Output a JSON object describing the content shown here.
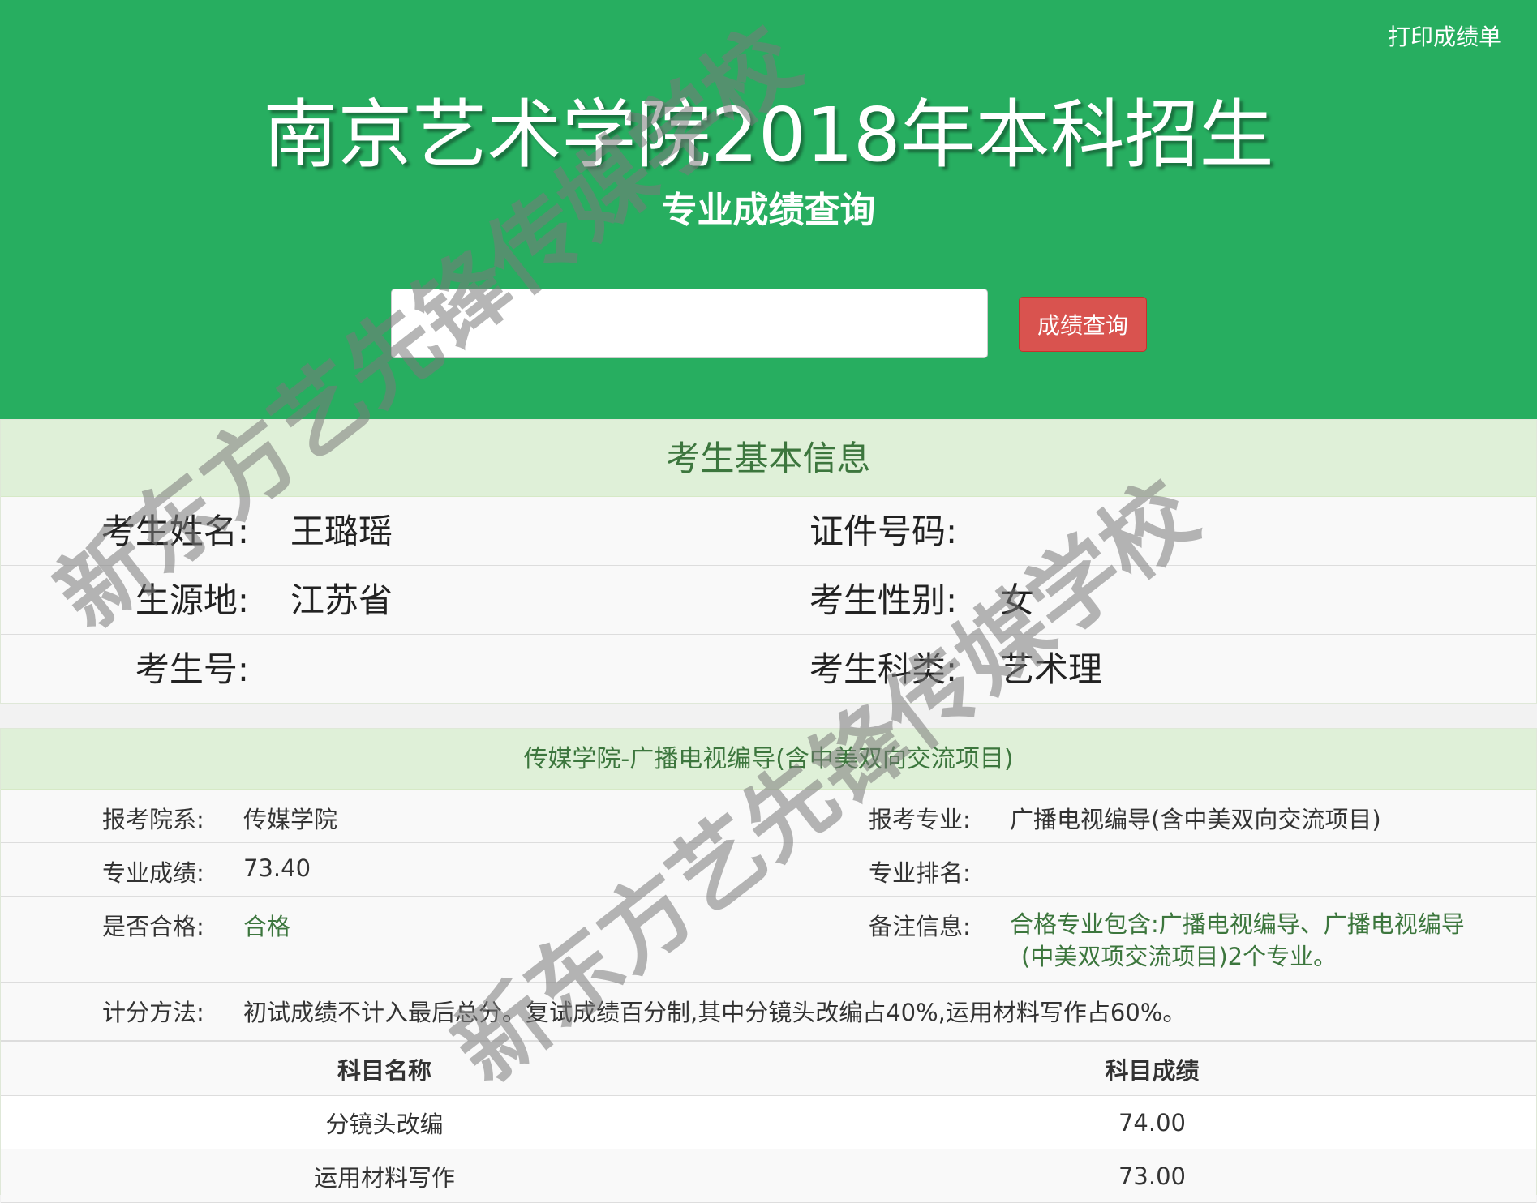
{
  "header": {
    "print_label": "打印成绩单",
    "title": "南京艺术学院2018年本科招生",
    "subtitle": "专业成绩查询",
    "search_value": "",
    "search_button": "成绩查询",
    "colors": {
      "background": "#27ae60",
      "button": "#d9534f"
    }
  },
  "basic_info": {
    "heading": "考生基本信息",
    "rows": [
      {
        "left_label": "考生姓名:",
        "left_value": "王璐瑶",
        "right_label": "证件号码:",
        "right_value": ""
      },
      {
        "left_label": "生源地:",
        "left_value": "江苏省",
        "right_label": "考生性别:",
        "right_value": "女"
      },
      {
        "left_label": "考生号:",
        "left_value": "",
        "right_label": "考生科类:",
        "right_value": "艺术理"
      }
    ]
  },
  "major": {
    "heading": "传媒学院-广播电视编导(含中美双向交流项目)",
    "department_label": "报考院系:",
    "department_value": "传媒学院",
    "major_label": "报考专业:",
    "major_value": "广播电视编导(含中美双向交流项目)",
    "score_label": "专业成绩:",
    "score_value": "73.40",
    "rank_label": "专业排名:",
    "rank_value": "",
    "pass_label": "是否合格:",
    "pass_value": "合格",
    "remark_label": "备注信息:",
    "remark_line1": "合格专业包含:广播电视编导、广播电视编导",
    "remark_line2": "(中美双项交流项目)2个专业。",
    "method_label": "计分方法:",
    "method_value": "初试成绩不计入最后总分。复试成绩百分制,其中分镜头改编占40%,运用材料写作占60%。",
    "table": {
      "headers": [
        "科目名称",
        "科目成绩"
      ],
      "rows": [
        {
          "subject": "分镜头改编",
          "score": "74.00"
        },
        {
          "subject": "运用材料写作",
          "score": "73.00"
        }
      ]
    }
  },
  "watermark": {
    "text": "新东方艺先锋传媒学校"
  }
}
